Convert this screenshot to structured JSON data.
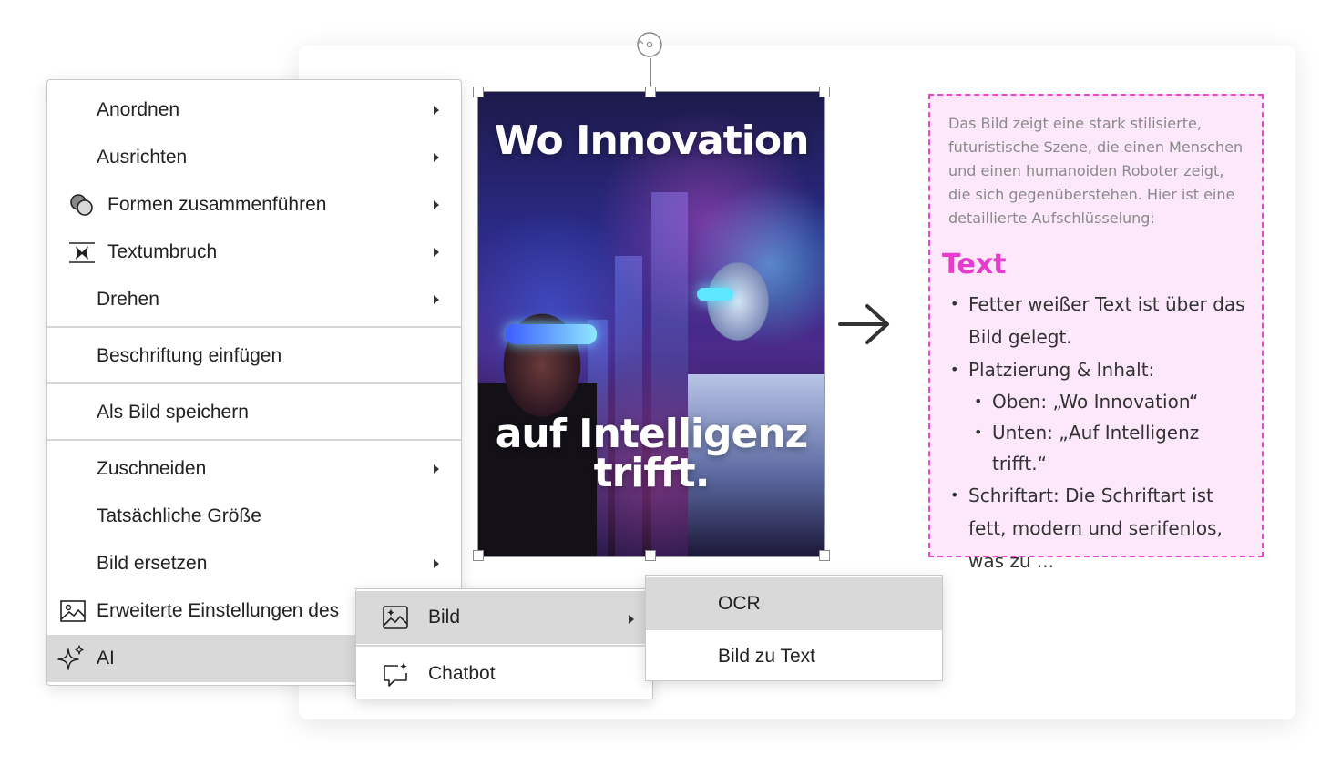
{
  "poster": {
    "top_text": "Wo Innovation",
    "bottom_text": "auf Intelligenz trifft."
  },
  "panel": {
    "description": "Das Bild zeigt eine stark stilisierte, futuristische Szene, die einen Menschen und einen humanoiden Roboter zeigt, die sich gegenüberstehen. Hier ist eine detaillierte Aufschlüsselung:",
    "heading": "Text",
    "bullets": [
      "Fetter weißer Text ist über das Bild gelegt.",
      "Platzierung & Inhalt:",
      "Oben: „Wo Innovation“",
      "Unten: „Auf Intelligenz trifft.“",
      "Schriftart: Die Schriftart ist fett, modern und serifenlos, was zu ..."
    ]
  },
  "context_menu": {
    "items": [
      {
        "label": "Anordnen",
        "submenu": true
      },
      {
        "label": "Ausrichten",
        "submenu": true
      },
      {
        "label": "Formen zusammenführen",
        "submenu": true,
        "icon": "merge-shapes-icon"
      },
      {
        "label": "Textumbruch",
        "submenu": true,
        "icon": "text-wrap-icon"
      },
      {
        "label": "Drehen",
        "submenu": true
      },
      {
        "label": "Beschriftung einfügen",
        "submenu": false
      },
      {
        "label": "Als Bild speichern",
        "submenu": false
      },
      {
        "label": "Zuschneiden",
        "submenu": true
      },
      {
        "label": "Tatsächliche Größe",
        "submenu": false
      },
      {
        "label": "Bild ersetzen",
        "submenu": true
      },
      {
        "label": "Erweiterte Einstellungen des",
        "submenu": false,
        "icon": "image-icon"
      },
      {
        "label": "AI",
        "submenu": true,
        "icon": "sparkle-icon",
        "active": true
      }
    ]
  },
  "ai_submenu": {
    "items": [
      {
        "label": "Bild",
        "icon": "image-sparkle-icon",
        "active": true,
        "submenu": true
      },
      {
        "label": "Chatbot",
        "icon": "chat-sparkle-icon"
      }
    ]
  },
  "bild_submenu": {
    "items": [
      {
        "label": "OCR",
        "active": true
      },
      {
        "label": "Bild zu Text"
      }
    ]
  },
  "colors": {
    "panel_border": "#ee44cc",
    "panel_bg": "#fde8fb",
    "heading": "#e63bcc",
    "menu_active": "#d9d9d9"
  }
}
